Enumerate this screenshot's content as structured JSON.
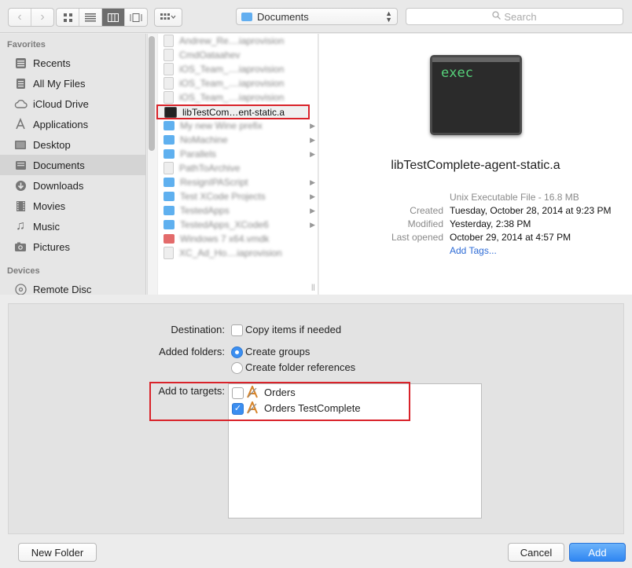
{
  "toolbar": {
    "location": "Documents",
    "search_placeholder": "Search"
  },
  "sidebar": {
    "favorites_heading": "Favorites",
    "devices_heading": "Devices",
    "items": [
      {
        "label": "Recents",
        "icon": "clock-icon"
      },
      {
        "label": "All My Files",
        "icon": "files-icon"
      },
      {
        "label": "iCloud Drive",
        "icon": "cloud-icon"
      },
      {
        "label": "Applications",
        "icon": "applications-icon"
      },
      {
        "label": "Desktop",
        "icon": "desktop-icon"
      },
      {
        "label": "Documents",
        "icon": "documents-icon"
      },
      {
        "label": "Downloads",
        "icon": "downloads-icon"
      },
      {
        "label": "Movies",
        "icon": "movies-icon"
      },
      {
        "label": "Music",
        "icon": "music-icon"
      },
      {
        "label": "Pictures",
        "icon": "pictures-icon"
      }
    ],
    "devices": [
      {
        "label": "Remote Disc",
        "icon": "disc-icon"
      }
    ]
  },
  "files": [
    {
      "name": "Andrew_Re....iaprovision",
      "type": "doc"
    },
    {
      "name": "CmdOataahev",
      "type": "doc"
    },
    {
      "name": "iOS_Team_....iaprovision",
      "type": "doc"
    },
    {
      "name": "iOS_Team_....iaprovision",
      "type": "doc"
    },
    {
      "name": "iOS_Team_....iaprovision",
      "type": "doc"
    },
    {
      "name": "libTestCom…ent-static.a",
      "type": "exe"
    },
    {
      "name": "My new Wine prefix",
      "type": "folder"
    },
    {
      "name": "NoMachine",
      "type": "folder"
    },
    {
      "name": "Parallels",
      "type": "folder"
    },
    {
      "name": "PathToArchive",
      "type": "doc"
    },
    {
      "name": "ResignIPAScript",
      "type": "folder"
    },
    {
      "name": "Test XCode Projects",
      "type": "folder"
    },
    {
      "name": "TestedApps",
      "type": "folder"
    },
    {
      "name": "TestedApps_XCode6",
      "type": "folder"
    },
    {
      "name": "Windows 7 x64.vmdk",
      "type": "red"
    },
    {
      "name": "XC_Ad_Ho....iaprovision",
      "type": "doc"
    }
  ],
  "preview": {
    "icon_text": "exec",
    "name": "libTestComplete-agent-static.a",
    "kind": "Unix Executable File - 16.8 MB",
    "created_label": "Created",
    "created": "Tuesday, October 28, 2014 at 9:23 PM",
    "modified_label": "Modified",
    "modified": "Yesterday, 2:38 PM",
    "opened_label": "Last opened",
    "opened": "October 29, 2014 at 4:57 PM",
    "add_tags": "Add Tags..."
  },
  "options": {
    "destination_label": "Destination:",
    "copy_items": "Copy items if needed",
    "added_folders_label": "Added folders:",
    "create_groups": "Create groups",
    "create_refs": "Create folder references",
    "targets_label": "Add to targets:",
    "targets": [
      {
        "name": "Orders",
        "checked": false
      },
      {
        "name": "Orders TestComplete",
        "checked": true
      }
    ]
  },
  "buttons": {
    "new_folder": "New Folder",
    "cancel": "Cancel",
    "add": "Add"
  },
  "colors": {
    "accent": "#3b8ef0",
    "highlight": "#d9232a"
  }
}
